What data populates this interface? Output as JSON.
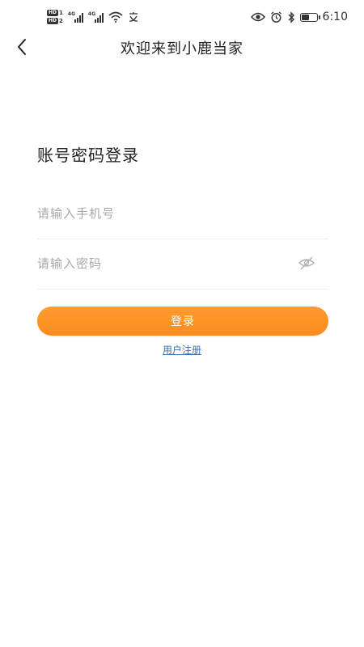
{
  "status_bar": {
    "sim1_label": "HD",
    "sim1_num": "1",
    "sim2_label": "HD",
    "sim2_num": "2",
    "net1": "4G",
    "net2": "4G",
    "time": "6:10",
    "battery_level": 0.55,
    "icons": [
      "wifi-icon",
      "message-icon",
      "eye-icon",
      "alarm-icon",
      "bluetooth-icon",
      "battery-icon"
    ]
  },
  "header": {
    "title": "欢迎来到小鹿当家",
    "back_icon": "chevron-left-icon"
  },
  "login": {
    "section_title": "账号密码登录",
    "phone_placeholder": "请输入手机号",
    "phone_value": "",
    "password_placeholder": "请输入密码",
    "password_value": "",
    "password_toggle_icon": "eye-off-icon",
    "login_button": "登录",
    "register_link": "用户注册"
  },
  "colors": {
    "accent": "#fb8d1d",
    "link": "#3b6fb6",
    "placeholder": "#a8a8a8",
    "divider": "#eeeeee"
  }
}
